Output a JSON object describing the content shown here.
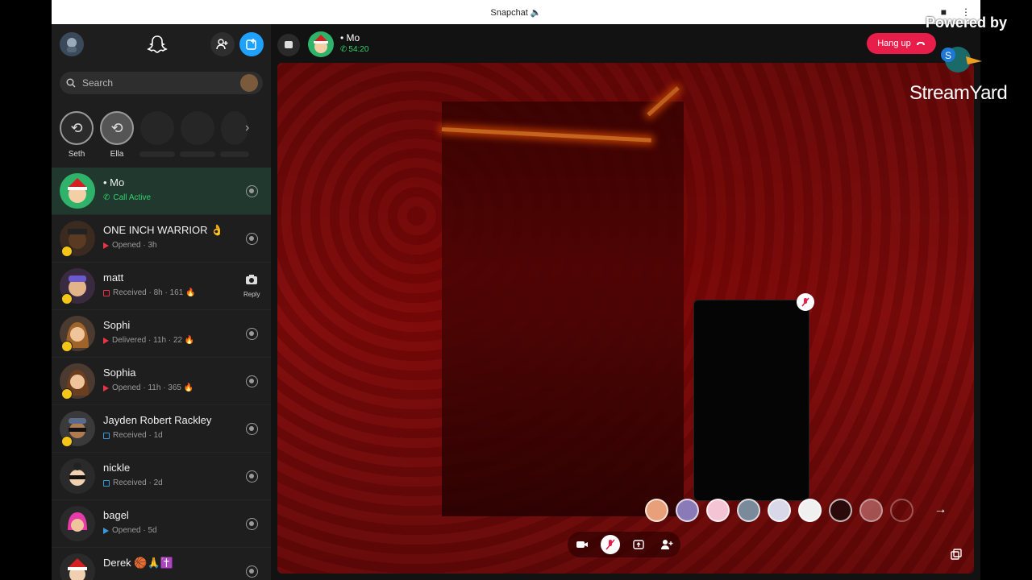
{
  "window": {
    "title": "Snapchat 🔈"
  },
  "sidebar": {
    "search_placeholder": "Search",
    "stories": [
      {
        "name": "Seth"
      },
      {
        "name": "Ella"
      }
    ],
    "chats": [
      {
        "name": "• Mo",
        "status": "Call Active",
        "status_color": "#2fd36b",
        "active": true
      },
      {
        "name": "ONE INCH WARRIOR 👌",
        "status": "Opened · 3h"
      },
      {
        "name": "matt",
        "status": "Received · 8h · 161 🔥",
        "action": "Reply"
      },
      {
        "name": "Sophi",
        "status": "Delivered · 11h · 22 🔥"
      },
      {
        "name": "Sophia",
        "status": "Opened · 11h · 365 🔥"
      },
      {
        "name": "Jayden Robert Rackley",
        "status": "Received · 1d"
      },
      {
        "name": "nickle",
        "status": "Received · 2d"
      },
      {
        "name": "bagel",
        "status": "Opened · 5d"
      },
      {
        "name": "Derek 🏀🙏✝️",
        "status": ""
      }
    ]
  },
  "call": {
    "contact": "• Mo",
    "duration": "54:20",
    "hangup_label": "Hang up"
  },
  "watermark": {
    "line1": "Powered by",
    "line2": "StreamYard"
  },
  "colors": {
    "accent_call": "#2fd36b",
    "hangup": "#e81d4a",
    "snap_red": "#e8334a",
    "chat_blue": "#3a9ad9",
    "new_chat": "#1fa1ff"
  }
}
